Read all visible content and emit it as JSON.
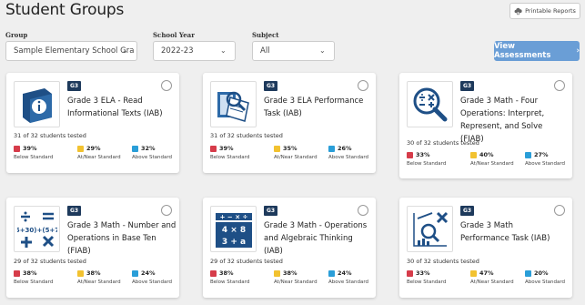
{
  "page": {
    "title": "Student Groups",
    "printable_reports": "Printable Reports"
  },
  "filters": {
    "group": {
      "label": "Group",
      "value": "Sample Elementary School Gra"
    },
    "school_year": {
      "label": "School Year",
      "value": "2022-23"
    },
    "subject": {
      "label": "Subject",
      "value": "All"
    }
  },
  "view_assessments": "View Assessments",
  "colors": {
    "below": "#d63c4a",
    "near": "#f2c230",
    "above": "#2a9ed8",
    "accent": "#6a9ed6",
    "icon": "#1e4f86"
  },
  "level_labels": {
    "below": "Below Standard",
    "near": "At/Near Standard",
    "above": "Above Standard"
  },
  "cards": [
    {
      "grade": "G3",
      "name": "Grade 3 ELA - Read Informational Texts (IAB)",
      "tested": "31 of 32 students tested",
      "below": "39%",
      "near": "29%",
      "above": "32%",
      "icon": "book-info-icon"
    },
    {
      "grade": "G3",
      "name": "Grade 3 ELA Performance Task (IAB)",
      "tested": "31 of 32 students tested",
      "below": "39%",
      "near": "35%",
      "above": "26%",
      "icon": "book-magnifier-icon"
    },
    {
      "grade": "G3",
      "name": "Grade 3 Math - Four Operations: Interpret, Represent, and Solve (FIAB)",
      "tested": "30 of 32 students tested",
      "below": "33%",
      "near": "40%",
      "above": "27%",
      "icon": "operations-magnifier-icon"
    },
    {
      "grade": "G3",
      "name": "Grade 3 Math - Number and Operations in Base Ten (FIAB)",
      "tested": "29 of 32 students tested",
      "below": "38%",
      "near": "38%",
      "above": "24%",
      "icon": "math-operators-icon"
    },
    {
      "grade": "G3",
      "name": "Grade 3 Math - Operations and Algebraic Thinking (IAB)",
      "tested": "29 of 32 students tested",
      "below": "38%",
      "near": "38%",
      "above": "24%",
      "icon": "algebra-blocks-icon"
    },
    {
      "grade": "G3",
      "name": "Grade 3 Math Performance Task (IAB)",
      "tested": "30 of 32 students tested",
      "below": "33%",
      "near": "47%",
      "above": "20%",
      "icon": "chart-magnifier-icon"
    }
  ]
}
